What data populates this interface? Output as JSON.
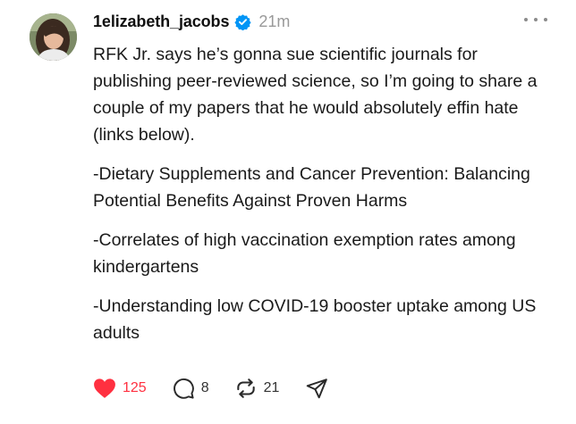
{
  "post": {
    "username": "1elizabeth_jacobs",
    "timestamp": "21m",
    "verified": true,
    "paragraphs": [
      "RFK Jr. says he’s gonna sue scientific journals for publishing peer-reviewed science, so I’m going to share a couple of my papers that he would absolutely effin hate (links below).",
      "-Dietary Supplements and Cancer Prevention: Balancing Potential Benefits Against Proven Harms",
      "-Correlates of high vaccination exemption rates among kindergartens",
      "-Understanding low COVID-19 booster uptake among US adults"
    ],
    "actions": {
      "likes": "125",
      "replies": "8",
      "reposts": "21"
    }
  },
  "colors": {
    "like_red": "#ff3040",
    "verified_blue": "#0095f6",
    "muted_gray": "#999999"
  },
  "icons": {
    "more": "more-horizontal-icon",
    "like": "heart-filled-icon",
    "reply": "comment-icon",
    "repost": "repost-icon",
    "share": "send-icon"
  }
}
